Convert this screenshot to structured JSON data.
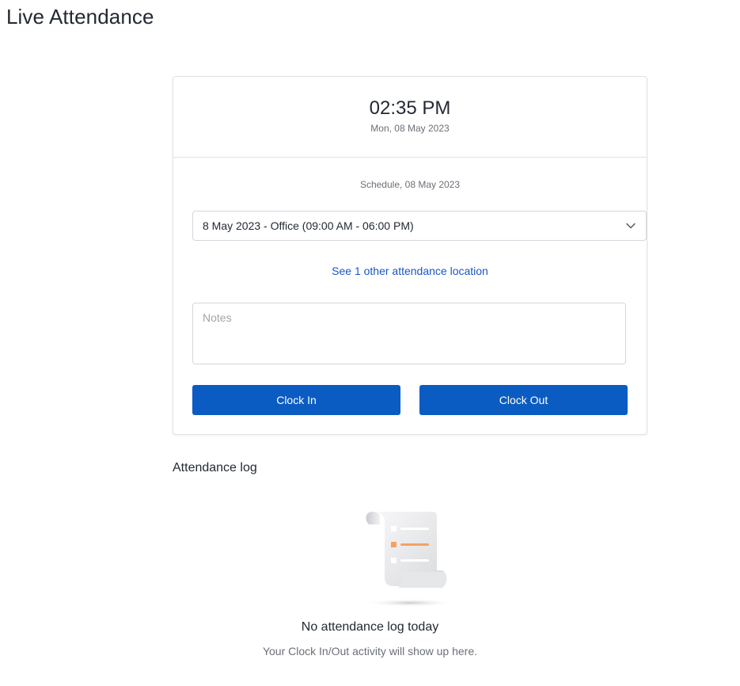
{
  "page": {
    "title": "Live Attendance"
  },
  "clock": {
    "time": "02:35 PM",
    "date": "Mon, 08 May 2023"
  },
  "schedule": {
    "label": "Schedule, 08 May 2023",
    "selected_shift": "8 May 2023 - Office (09:00 AM - 06:00 PM)",
    "other_location_link": "See 1 other attendance location"
  },
  "notes": {
    "placeholder": "Notes",
    "value": ""
  },
  "actions": {
    "clock_in_label": "Clock In",
    "clock_out_label": "Clock Out"
  },
  "attendance_log": {
    "title": "Attendance log",
    "empty_title": "No attendance log today",
    "empty_subtitle": "Your Clock In/Out activity will show up here."
  },
  "colors": {
    "primary": "#0b5cc2",
    "link": "#1a56c9",
    "text": "#232933",
    "muted": "#6b6f76",
    "border": "#dfe1e5",
    "accent_orange": "#f4a261"
  }
}
